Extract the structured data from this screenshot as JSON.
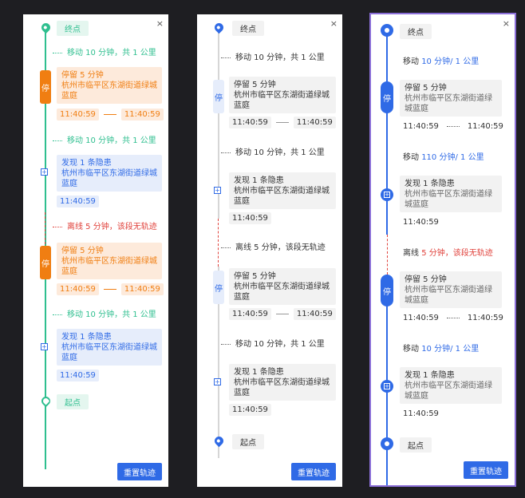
{
  "close_symbol": "×",
  "end_label": "终点",
  "start_label": "起点",
  "stop_badge": "停",
  "reset_button": "重置轨迹",
  "time_start": "11:40:59",
  "time_end": "11:40:59",
  "stop_title": "停留 5 分钟",
  "address": "杭州市临平区东湖街道绿城蓝庭",
  "hazard_title": "发现 1 条隐患",
  "hazard_time": "11:40:59",
  "move_text": "移动 10 分钟，共 1 公里",
  "offline_text": "离线 5 分钟，该段无轨迹",
  "v3": {
    "move_a": {
      "prefix": "移动 ",
      "minutes": "10",
      "mid": " 分钟/ ",
      "km": "1",
      "suffix": " 公里"
    },
    "move_b": {
      "prefix": "移动 ",
      "minutes": "110",
      "mid": " 分钟/ ",
      "km": "1",
      "suffix": " 公里"
    },
    "offline": {
      "prefix": "离线 ",
      "minutes": "5",
      "suffix": " 分钟，该段无轨迹"
    }
  },
  "colors": {
    "green": "#2fbf8f",
    "orange": "#f07e12",
    "orange_bg": "#fdeadb",
    "blue": "#2f6ae6",
    "blue_bg": "#e6edfb",
    "gray_bg": "#f2f2f2",
    "red": "#e0403a"
  }
}
